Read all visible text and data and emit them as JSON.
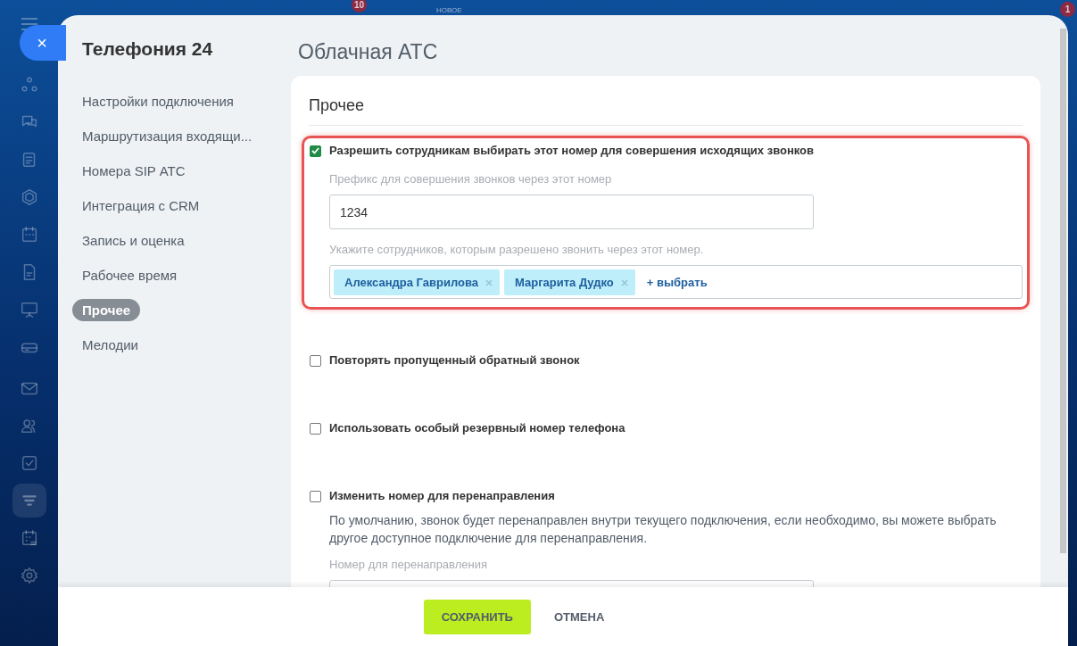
{
  "topbar": {
    "notice": "НОВОЕ",
    "badges": [
      {
        "count": "10"
      },
      {
        "count": "1"
      }
    ]
  },
  "rail": {
    "items": [
      {
        "selected": false
      },
      {
        "selected": false
      },
      {
        "selected": false
      },
      {
        "selected": false
      },
      {
        "selected": false
      },
      {
        "selected": false
      },
      {
        "selected": false
      },
      {
        "selected": false
      },
      {
        "selected": false
      },
      {
        "selected": false
      },
      {
        "selected": false
      },
      {
        "selected": true
      },
      {
        "selected": false
      },
      {
        "selected": false
      }
    ]
  },
  "panel": {
    "title": "Телефония 24",
    "close": "×",
    "nav": [
      {
        "label": "Настройки подключения",
        "selected": false
      },
      {
        "label": "Маршрутизация входящи...",
        "selected": false
      },
      {
        "label": "Номера SIP АТС",
        "selected": false
      },
      {
        "label": "Интеграция с CRM",
        "selected": false
      },
      {
        "label": "Запись и оценка",
        "selected": false
      },
      {
        "label": "Рабочее время",
        "selected": false
      },
      {
        "label": "Прочее",
        "selected": true
      },
      {
        "label": "Мелодии",
        "selected": false
      }
    ],
    "page_title": "Облачная АТС",
    "section_title": "Прочее",
    "options": [
      {
        "label": "Разрешить сотрудникам выбирать этот номер для совершения исходящих звонков",
        "checked": true,
        "highlighted": true,
        "fields": [
          {
            "kind": "text",
            "label": "Префикс для совершения звонков через этот номер",
            "value": "1234"
          },
          {
            "kind": "users",
            "label": "Укажите сотрудников, которым разрешено звонить через этот номер.",
            "tags": [
              "Александра Гаврилова",
              "Маргарита Дудко"
            ],
            "add_label": "+ выбрать"
          }
        ]
      },
      {
        "label": "Повторять пропущенный обратный звонок",
        "checked": false,
        "highlighted": false
      },
      {
        "label": "Использовать особый резервный номер телефона",
        "checked": false,
        "highlighted": false
      },
      {
        "label": "Изменить номер для перенаправления",
        "checked": false,
        "highlighted": false,
        "description": "По умолчанию, звонок будет перенаправлен внутри текущего подключения, если необходимо, вы можете выбрать другое доступное подключение для перенаправления.",
        "fields": [
          {
            "kind": "text",
            "label": "Номер для перенаправления"
          }
        ]
      }
    ],
    "buttons": [
      {
        "label": "СОХРАНИТЬ",
        "kind": "primary"
      },
      {
        "label": "ОТМЕНА",
        "kind": "link"
      }
    ]
  }
}
